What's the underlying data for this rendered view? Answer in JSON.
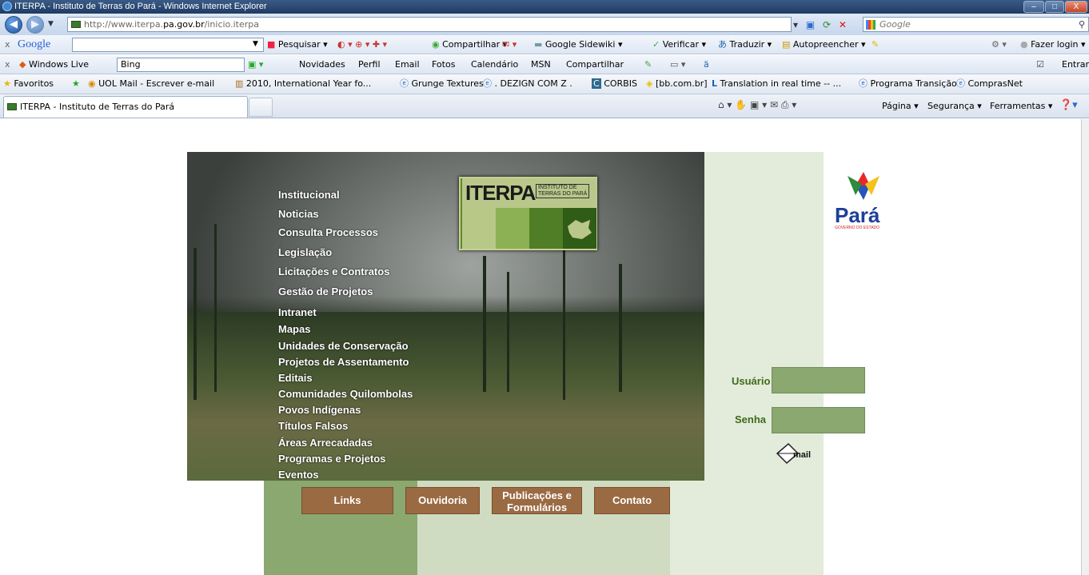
{
  "window": {
    "title": "ITERPA - Instituto de Terras do Pará - Windows Internet Explorer",
    "minimize": "–",
    "maximize": "□",
    "close": "X"
  },
  "address_bar": {
    "url_prefix": "http://www.iterpa.",
    "url_domain": "pa.gov.br",
    "url_suffix": "/inicio.iterpa",
    "search_placeholder": "Google"
  },
  "google_toolbar": {
    "logo": "Google",
    "items": [
      "Pesquisar ▾",
      "Compartilhar ▾",
      "Google Sidewiki ▾",
      "Verificar ▾",
      "Traduzir ▾",
      "Autopreencher ▾"
    ],
    "login": "Fazer login ▾"
  },
  "live_toolbar": {
    "brand": "Windows Live",
    "search_value": "Bing",
    "items": [
      "Novidades",
      "Perfil",
      "Email",
      "Fotos",
      "Calendário",
      "MSN",
      "Compartilhar"
    ],
    "signin": "Entrar"
  },
  "favorites_bar": {
    "label": "Favoritos",
    "items": [
      "UOL Mail - Escrever e-mail",
      "2010, International Year fo...",
      "Grunge Textures",
      ". DEZIGN COM Z .",
      "CORBIS",
      "[bb.com.br]",
      "Translation in real time -- ...",
      "Programa Transição",
      "ComprasNet"
    ]
  },
  "tab": {
    "label": "ITERPA - Instituto de Terras do Pará"
  },
  "command_bar": {
    "items": [
      "Página ▾",
      "Segurança ▾",
      "Ferramentas ▾"
    ]
  },
  "site": {
    "logo_word": "ITERPA",
    "logo_sub_line1": "INSTITUTO DE",
    "logo_sub_line2": "TERRAS DO PARÁ",
    "menu": [
      "Institucional",
      "Noticias",
      "Consulta Processos",
      "Legislação",
      "Licitações e Contratos",
      "Gestão de Projetos",
      "Intranet",
      "Mapas",
      "Unidades de Conservação",
      "Projetos de Assentamento",
      "Editais",
      "Comunidades Quilombolas",
      "Povos Indígenas",
      "Títulos Falsos",
      "Áreas Arrecadadas",
      "Programas e Projetos",
      "Eventos"
    ],
    "buttons": {
      "links": "Links",
      "ouvidoria": "Ouvidoria",
      "publicacoes_line1": "Publicações e",
      "publicacoes_line2": "Formulários",
      "contato": "Contato"
    },
    "para_logo_text": "Pará",
    "para_logo_sub": "GOVERNO DO ESTADO",
    "login": {
      "user_label": "Usuário",
      "password_label": "Senha",
      "mail_label": "mail"
    }
  }
}
